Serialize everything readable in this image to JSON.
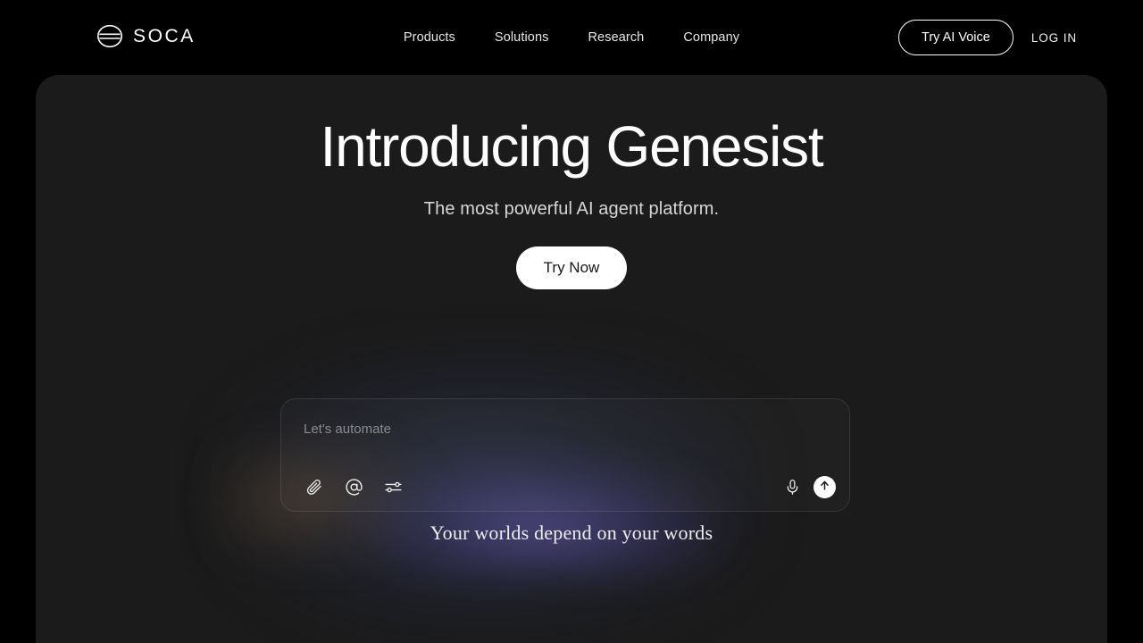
{
  "brand": {
    "name": "SOCA",
    "logo_icon": "soca-ellipse-lines-logo"
  },
  "nav": {
    "links": [
      {
        "label": "Products"
      },
      {
        "label": "Solutions"
      },
      {
        "label": "Research"
      },
      {
        "label": "Company"
      }
    ],
    "try_ai_voice_label": "Try AI Voice",
    "login_label": "LOG IN"
  },
  "hero": {
    "title": "Introducing Genesist",
    "subtitle": "The most powerful AI agent platform.",
    "cta_label": "Try Now"
  },
  "composer": {
    "placeholder": "Let's automate",
    "value": "",
    "left_tools": [
      {
        "icon": "paperclip-icon",
        "name": "attach-file-button"
      },
      {
        "icon": "at-mention-icon",
        "name": "mention-button"
      },
      {
        "icon": "sliders-tune-icon",
        "name": "settings-tune-button"
      }
    ],
    "right_tools": [
      {
        "icon": "microphone-icon",
        "name": "voice-input-button"
      },
      {
        "icon": "arrow-up-icon",
        "name": "send-button"
      }
    ]
  },
  "tagline": "Your worlds depend on your words",
  "colors": {
    "page_background": "#000000",
    "panel_background": "#1b1b1b",
    "accent_white": "#ffffff",
    "glow_blue": "#5668aa",
    "glow_violet": "#806cdc",
    "glow_amber": "#c49656",
    "text_primary": "#fdfdfd",
    "text_secondary": "#d6d6d6",
    "placeholder": "#8b8b8b"
  }
}
